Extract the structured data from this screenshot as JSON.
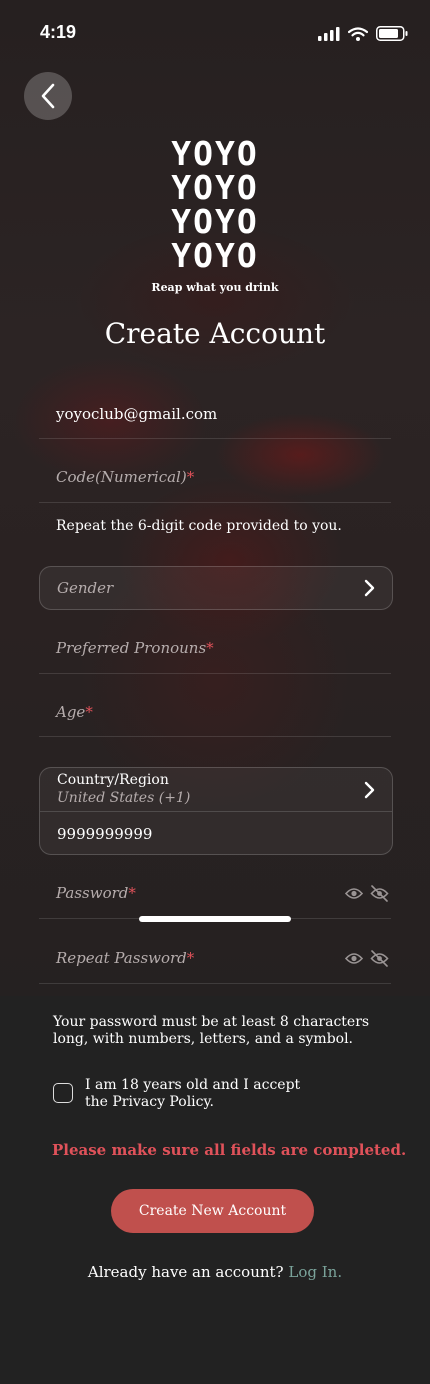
{
  "status_bar": {
    "time": "4:19"
  },
  "logo": {
    "lines": [
      "YOYO",
      "YOYO",
      "YOYO",
      "YOYO"
    ],
    "tagline": "Reap what you drink"
  },
  "title": "Create Account",
  "form": {
    "email_value": "yoyoclub@gmail.com",
    "code_placeholder": "Code(Numerical)",
    "code_hint": "Repeat the 6-digit code provided to you.",
    "gender_placeholder": "Gender",
    "pronouns_placeholder": "Preferred Pronouns",
    "age_placeholder": "Age",
    "country_label": "Country/Region",
    "country_value": "United States (+1)",
    "phone_value": "9999999999",
    "password_placeholder": "Password",
    "repeat_password_placeholder": "Repeat Password",
    "required_mark": "*"
  },
  "password_note": "Your password must be at least 8 characters long, with numbers, letters, and a symbol.",
  "consent_label": "I am 18 years old and I accept the Privacy Policy.",
  "error_message": "Please make sure all fields are completed.",
  "cta_label": "Create New Account",
  "login_prompt": "Already have an account?",
  "login_link": "Log In.",
  "colors": {
    "accent": "#c0504d",
    "error": "#e0525a",
    "link": "#7aa39a",
    "background": "#222222"
  },
  "icons": [
    "back-chevron-icon",
    "chevron-right-icon",
    "eye-icon",
    "eye-off-icon",
    "signal-icon",
    "wifi-icon",
    "battery-icon"
  ]
}
